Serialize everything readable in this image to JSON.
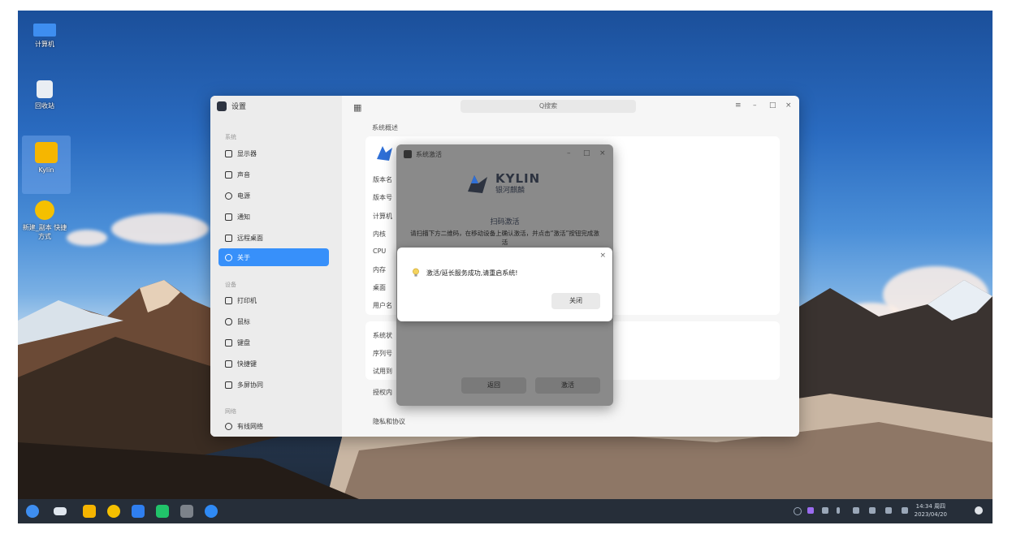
{
  "desktop": {
    "icons": [
      {
        "label": "计算机"
      },
      {
        "label": "回收站"
      },
      {
        "label": "Kylin"
      },
      {
        "label": "新建_副本 快捷方式"
      }
    ]
  },
  "settings": {
    "app_title": "设置",
    "search_placeholder": "Q搜索",
    "group_system": "系统",
    "group_devices": "设备",
    "group_network": "网络",
    "nav_items": [
      {
        "label": "显示器"
      },
      {
        "label": "声音"
      },
      {
        "label": "电源"
      },
      {
        "label": "通知"
      },
      {
        "label": "远程桌面"
      },
      {
        "label": "关于"
      },
      {
        "label": "打印机"
      },
      {
        "label": "鼠标"
      },
      {
        "label": "键盘"
      },
      {
        "label": "快捷键"
      },
      {
        "label": "多屏协同"
      },
      {
        "label": "有线网络"
      }
    ],
    "section_title": "系统概述",
    "info_labels": [
      "版本名",
      "版本号",
      "计算机",
      "内核",
      "CPU",
      "内存",
      "桌面",
      "用户名"
    ],
    "status_labels": [
      "系统状",
      "序列号",
      "试用到",
      "授权内"
    ],
    "activate_button": "激活",
    "privacy": "隐私和协议"
  },
  "activation_dialog": {
    "title": "系统激活",
    "brand_en": "KYLIN",
    "brand_cn": "银河麒麟",
    "scan_title": "扫码激活",
    "scan_desc": "请扫描下方二维码，在移动设备上确认激活，并点击“激活”按钮完成激活",
    "back_button": "返回",
    "activate_button": "激活"
  },
  "message_box": {
    "text": "激活/延长服务成功,请重启系统!",
    "close_button": "关闭"
  },
  "taskbar": {
    "time": "14:34 周四",
    "date": "2023/04/20"
  }
}
